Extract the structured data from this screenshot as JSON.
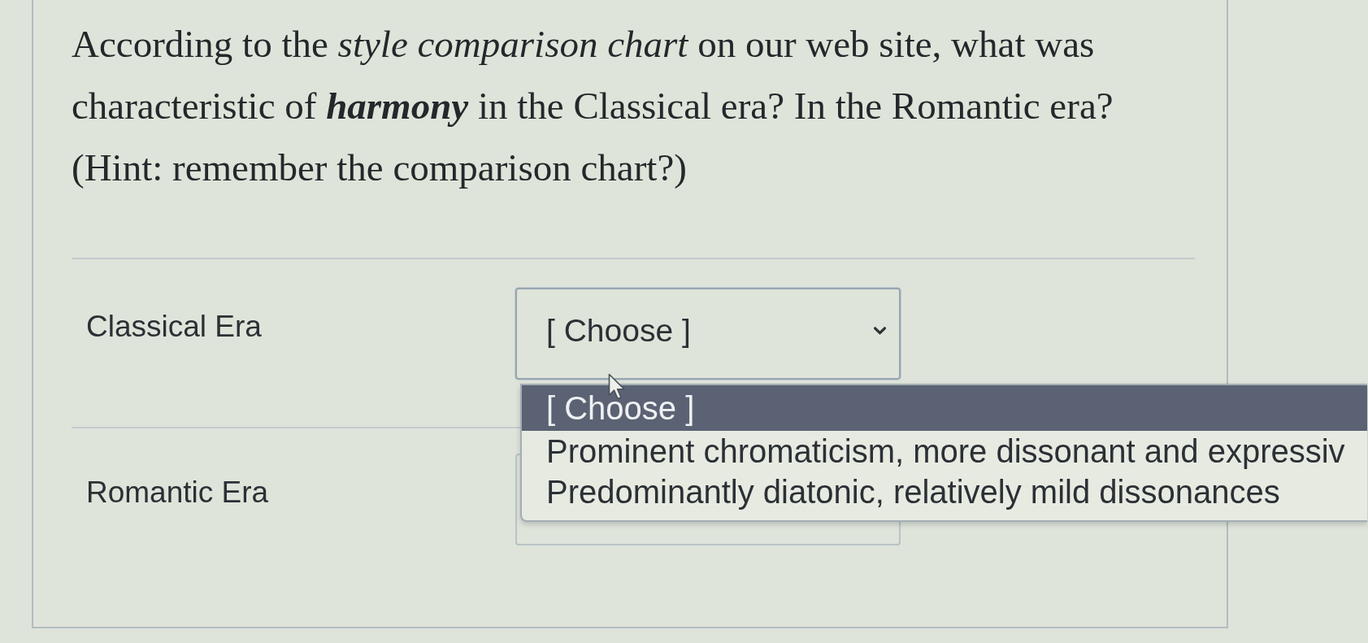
{
  "question": {
    "text": "According to the *style comparison chart* on our web site, what was characteristic of **harmony** in the Classical era? In the Romantic era?",
    "hint": "(Hint: remember the comparison chart?)"
  },
  "rows": [
    {
      "label": "Classical Era",
      "select": {
        "value": "[ Choose ]",
        "expanded": true,
        "options": [
          {
            "text": "[ Choose ]",
            "selected": true
          },
          {
            "text": "Prominent chromaticism, more dissonant and expressiv",
            "selected": false
          },
          {
            "text": "Predominantly diatonic, relatively mild dissonances",
            "selected": false
          }
        ]
      }
    },
    {
      "label": "Romantic Era",
      "select": {
        "expanded": false
      }
    }
  ]
}
